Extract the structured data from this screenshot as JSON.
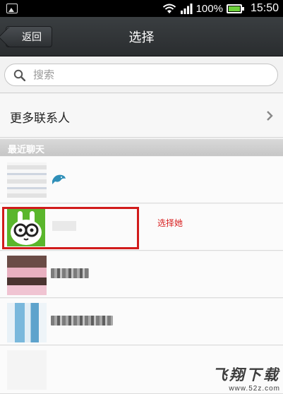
{
  "status_bar": {
    "battery_percent": "100%",
    "time": "15:50"
  },
  "header": {
    "back_label": "返回",
    "title": "选择"
  },
  "search": {
    "placeholder": "搜索"
  },
  "more_contacts": {
    "label": "更多联系人"
  },
  "recent_section": {
    "label": "最近聊天"
  },
  "annotation": {
    "text": "选择她"
  },
  "colors": {
    "title_bar": "#2f3234",
    "highlight": "#d11b1b",
    "annotation": "#d81e1e",
    "avatar_green": "#5ab62c"
  },
  "watermark": {
    "main": "飞翔下载",
    "sub": "www.52z.com"
  }
}
